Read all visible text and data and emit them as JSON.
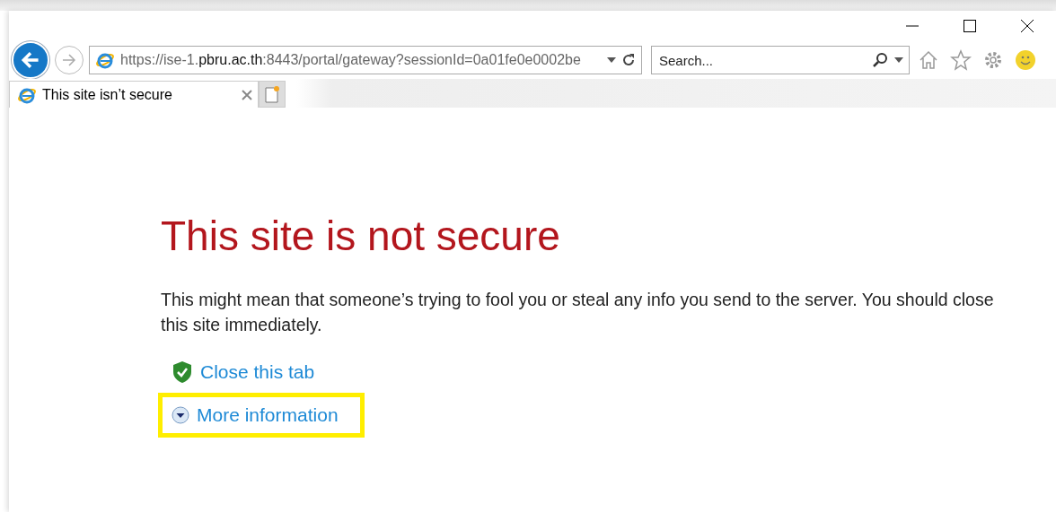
{
  "address": {
    "prefix": "https://ise-1.",
    "domain": "pbru.ac.th",
    "suffix": ":8443/portal/gateway?sessionId=0a01fe0e0002be"
  },
  "search": {
    "placeholder": "Search..."
  },
  "tabs": [
    {
      "label": "This site isn’t secure",
      "selected": true
    }
  ],
  "page": {
    "heading": "This site is not secure",
    "message": "This might mean that someone’s trying to fool you or steal any info you send to the server. You should close this site immediately.",
    "links": [
      {
        "kind": "shield",
        "label": "Close this tab",
        "highlighted": false
      },
      {
        "kind": "expand",
        "label": "More information",
        "highlighted": true
      }
    ]
  }
}
